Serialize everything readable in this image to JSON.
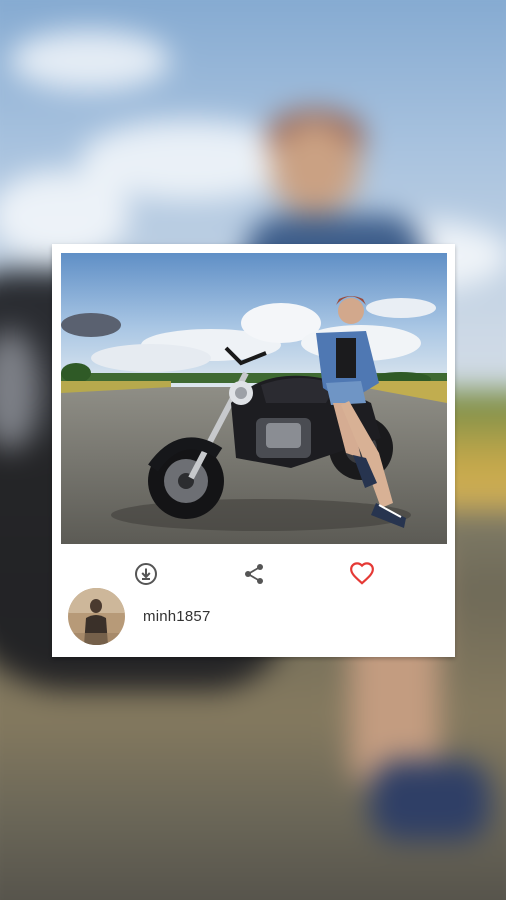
{
  "post": {
    "photo": {
      "subject": "woman-sitting-on-motorcycle-photo"
    },
    "actions": {
      "download_icon": "download-icon",
      "share_icon": "share-icon",
      "like_icon": "heart-icon",
      "like_color": "#e53935",
      "icon_color": "#555555"
    },
    "author": {
      "username": "minh1857",
      "avatar_icon": "avatar"
    }
  },
  "colors": {
    "card_background": "#ffffff",
    "username_text": "#333333"
  }
}
